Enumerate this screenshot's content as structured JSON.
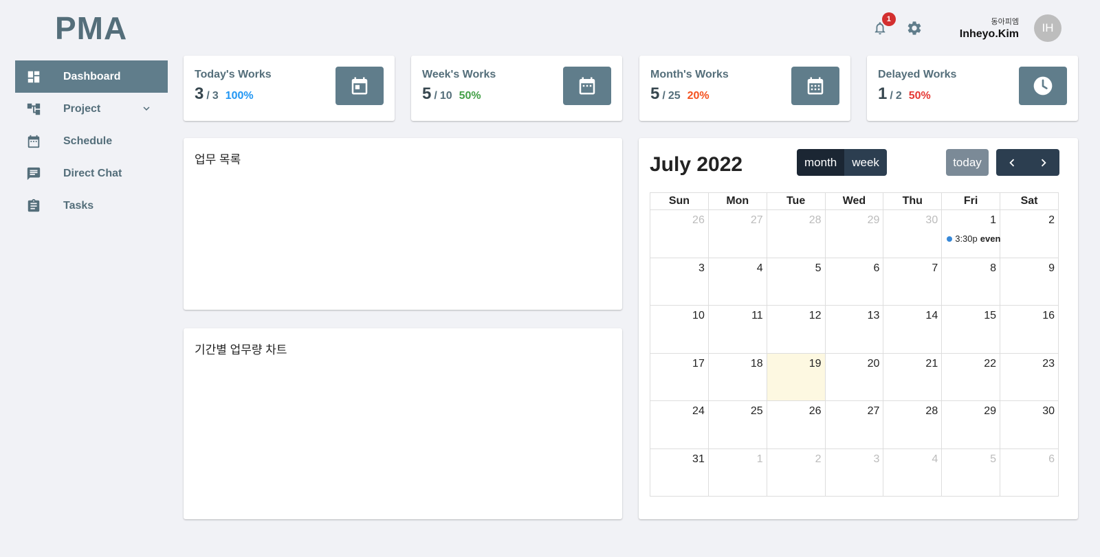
{
  "header": {
    "logo": "PMA",
    "notification_count": "1",
    "user_org": "동아피엠",
    "user_name": "Inheyo.Kim",
    "avatar_initials": "IH"
  },
  "sidebar": {
    "items": [
      {
        "label": "Dashboard",
        "icon": "dashboard-icon",
        "active": true
      },
      {
        "label": "Project",
        "icon": "project-tree-icon",
        "expandable": true
      },
      {
        "label": "Schedule",
        "icon": "calendar-icon"
      },
      {
        "label": "Direct Chat",
        "icon": "chat-icon"
      },
      {
        "label": "Tasks",
        "icon": "clipboard-icon"
      }
    ]
  },
  "stats": [
    {
      "title": "Today's Works",
      "value": "3",
      "sep": "/",
      "total": "3",
      "percent": "100%",
      "percent_color": "#2196f3",
      "icon": "calendar-day-icon"
    },
    {
      "title": "Week's Works",
      "value": "5",
      "sep": "/",
      "total": "10",
      "percent": "50%",
      "percent_color": "#43a047",
      "icon": "calendar-week-icon"
    },
    {
      "title": "Month's Works",
      "value": "5",
      "sep": "/",
      "total": "25",
      "percent": "20%",
      "percent_color": "#f4511e",
      "icon": "calendar-month-icon"
    },
    {
      "title": "Delayed Works",
      "value": "1",
      "sep": "/",
      "total": "2",
      "percent": "50%",
      "percent_color": "#e53935",
      "icon": "clock-icon"
    }
  ],
  "panels": {
    "work_list_title": "업무 목록",
    "work_chart_title": "기간별 업무량 차트"
  },
  "calendar": {
    "title": "July 2022",
    "view_month": "month",
    "view_week": "week",
    "today_label": "today",
    "weekdays": [
      "Sun",
      "Mon",
      "Tue",
      "Wed",
      "Thu",
      "Fri",
      "Sat"
    ],
    "weeks": [
      [
        {
          "d": "26",
          "o": true
        },
        {
          "d": "27",
          "o": true
        },
        {
          "d": "28",
          "o": true
        },
        {
          "d": "29",
          "o": true
        },
        {
          "d": "30",
          "o": true
        },
        {
          "d": "1",
          "e": {
            "time": "3:30p",
            "title": "even"
          }
        },
        {
          "d": "2"
        }
      ],
      [
        {
          "d": "3"
        },
        {
          "d": "4"
        },
        {
          "d": "5"
        },
        {
          "d": "6"
        },
        {
          "d": "7"
        },
        {
          "d": "8"
        },
        {
          "d": "9"
        }
      ],
      [
        {
          "d": "10"
        },
        {
          "d": "11"
        },
        {
          "d": "12"
        },
        {
          "d": "13"
        },
        {
          "d": "14"
        },
        {
          "d": "15"
        },
        {
          "d": "16"
        }
      ],
      [
        {
          "d": "17"
        },
        {
          "d": "18"
        },
        {
          "d": "19",
          "t": true
        },
        {
          "d": "20"
        },
        {
          "d": "21"
        },
        {
          "d": "22"
        },
        {
          "d": "23"
        }
      ],
      [
        {
          "d": "24"
        },
        {
          "d": "25"
        },
        {
          "d": "26"
        },
        {
          "d": "27"
        },
        {
          "d": "28"
        },
        {
          "d": "29"
        },
        {
          "d": "30"
        }
      ],
      [
        {
          "d": "31"
        },
        {
          "d": "1",
          "o": true
        },
        {
          "d": "2",
          "o": true
        },
        {
          "d": "3",
          "o": true
        },
        {
          "d": "4",
          "o": true
        },
        {
          "d": "5",
          "o": true
        },
        {
          "d": "6",
          "o": true
        }
      ]
    ]
  }
}
